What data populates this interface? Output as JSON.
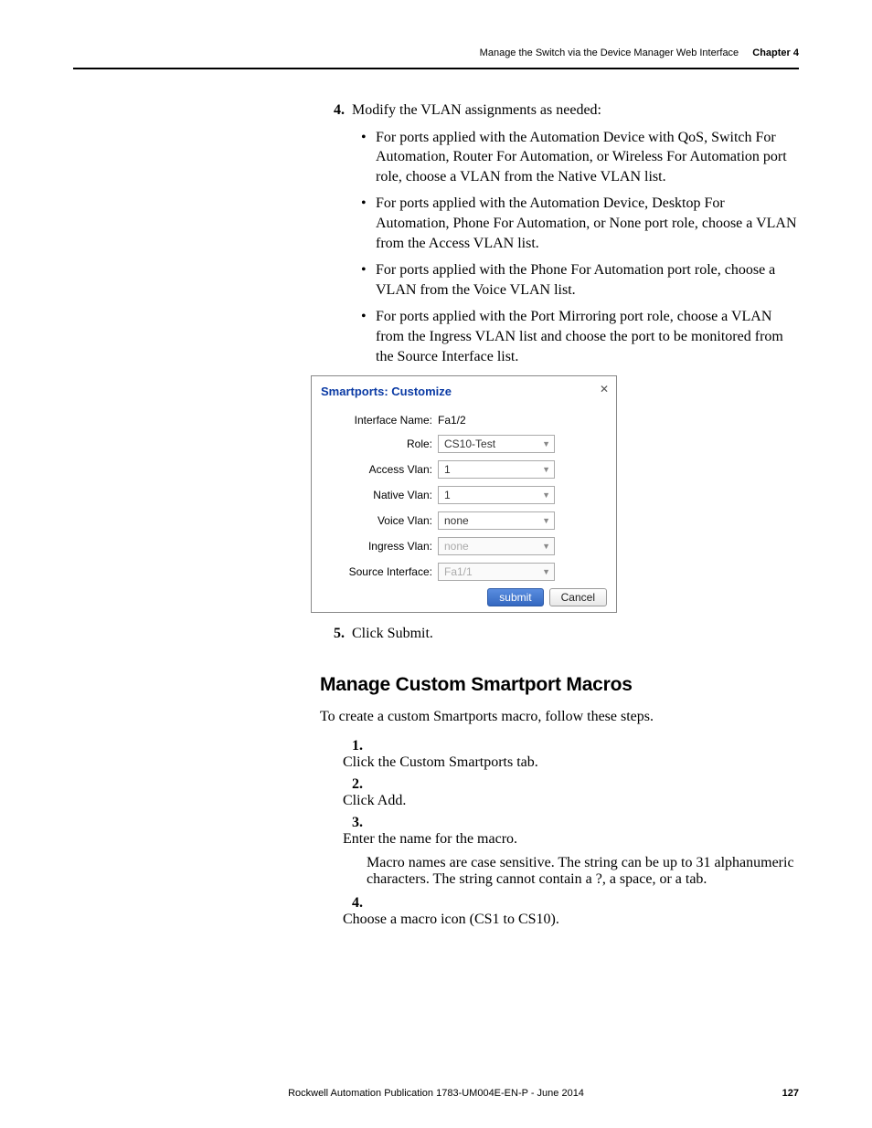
{
  "header": {
    "section": "Manage the Switch via the Device Manager Web Interface",
    "chapter": "Chapter 4"
  },
  "list1": {
    "item4_marker": "4.",
    "item4_text": "Modify the VLAN assignments as needed:",
    "bullets": [
      "For ports applied with the Automation Device with QoS, Switch For Automation, Router For Automation, or Wireless For Automation port role, choose a VLAN from the Native VLAN list.",
      "For ports applied with the Automation Device, Desktop For Automation, Phone For Automation, or None port role, choose a VLAN from the Access VLAN list.",
      "For ports applied with the Phone For Automation port role, choose a VLAN from the Voice VLAN list.",
      "For ports applied with the Port Mirroring port role, choose a VLAN from the Ingress VLAN list and choose the port to be monitored from the Source Interface list."
    ],
    "item5_marker": "5.",
    "item5_text": "Click Submit."
  },
  "dialog": {
    "title": "Smartports: Customize",
    "iface_label": "Interface Name:",
    "iface_value": "Fa1/2",
    "role_label": "Role:",
    "role_value": "CS10-Test",
    "access_label": "Access Vlan:",
    "access_value": "1",
    "native_label": "Native Vlan:",
    "native_value": "1",
    "voice_label": "Voice Vlan:",
    "voice_value": "none",
    "ingress_label": "Ingress Vlan:",
    "ingress_value": "none",
    "srcif_label": "Source Interface:",
    "srcif_value": "Fa1/1",
    "submit": "submit",
    "cancel": "Cancel"
  },
  "section2": {
    "heading": "Manage Custom Smartport Macros",
    "intro": "To create a custom Smartports macro, follow these steps.",
    "items": [
      {
        "m": "1.",
        "t": "Click the Custom Smartports tab."
      },
      {
        "m": "2.",
        "t": "Click Add."
      },
      {
        "m": "3.",
        "t": "Enter the name for the macro."
      },
      {
        "m": "4.",
        "t": "Choose a macro icon (CS1 to CS10)."
      }
    ],
    "note": "Macro names are case sensitive. The string can be up to 31 alphanumeric characters. The string cannot contain a ?, a space, or a tab."
  },
  "footer": {
    "pub": "Rockwell Automation Publication 1783-UM004E-EN-P - June 2014",
    "page": "127"
  }
}
